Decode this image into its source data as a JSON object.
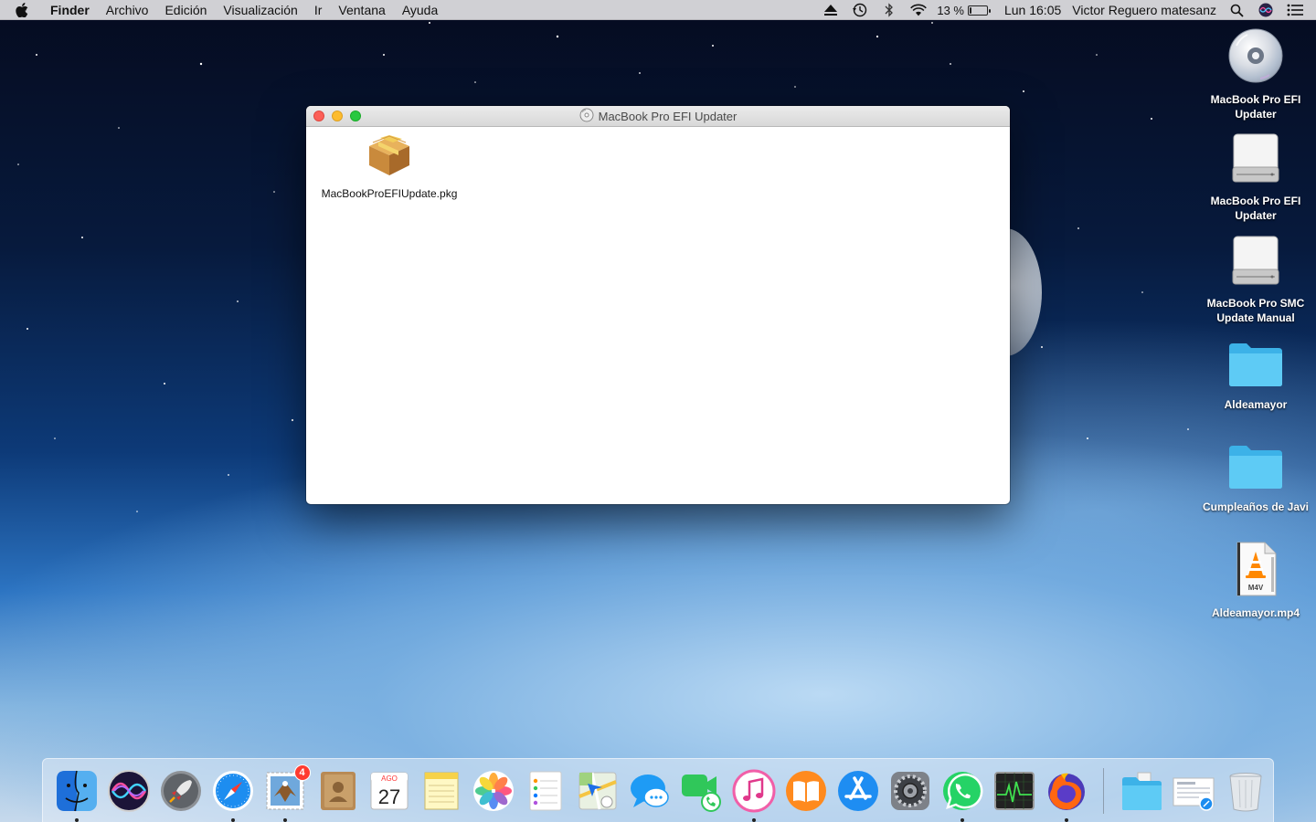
{
  "menubar": {
    "app_name": "Finder",
    "menus": [
      "Archivo",
      "Edición",
      "Visualización",
      "Ir",
      "Ventana",
      "Ayuda"
    ],
    "battery_percent": "13 %",
    "battery_level": 0.13,
    "clock": "Lun 16:05",
    "user_name": "Victor Reguero matesanz",
    "status_icons": [
      "eject-icon",
      "time-machine-icon",
      "bluetooth-icon",
      "wifi-icon",
      "battery-icon",
      "spotlight-search-icon",
      "siri-icon",
      "notification-center-icon"
    ]
  },
  "window": {
    "title": "MacBook Pro EFI Updater",
    "title_icon": "disc-icon",
    "files": [
      {
        "name": "MacBookProEFIUpdate.pkg",
        "icon": "package-icon"
      }
    ]
  },
  "desktop": {
    "icons": [
      {
        "label": "MacBook Pro EFI Updater",
        "icon": "cd-disc-icon"
      },
      {
        "label": "MacBook Pro EFI Updater",
        "icon": "disk-image-icon"
      },
      {
        "label": "MacBook Pro SMC Update Manual",
        "icon": "disk-image-icon"
      },
      {
        "label": "Aldeamayor",
        "icon": "folder-icon"
      },
      {
        "label": "Cumpleaños de Javi",
        "icon": "folder-icon"
      },
      {
        "label": "Aldeamayor.mp4",
        "icon": "vlc-video-file-icon",
        "file_type": "M4V"
      }
    ]
  },
  "dock": {
    "apps": [
      {
        "name": "Finder",
        "running": true
      },
      {
        "name": "Siri",
        "running": false
      },
      {
        "name": "Launchpad",
        "running": false
      },
      {
        "name": "Safari",
        "running": true
      },
      {
        "name": "Mail",
        "running": true,
        "badge": "4"
      },
      {
        "name": "Contacts",
        "running": false
      },
      {
        "name": "Calendar",
        "running": false,
        "month": "AGO",
        "day": "27"
      },
      {
        "name": "Notes",
        "running": false
      },
      {
        "name": "Photos",
        "running": false
      },
      {
        "name": "Reminders",
        "running": false
      },
      {
        "name": "Maps",
        "running": false
      },
      {
        "name": "Messages",
        "running": false
      },
      {
        "name": "FaceTime",
        "running": false
      },
      {
        "name": "iTunes",
        "running": true
      },
      {
        "name": "iBooks",
        "running": false
      },
      {
        "name": "App Store",
        "running": false
      },
      {
        "name": "System Preferences",
        "running": false
      },
      {
        "name": "WhatsApp",
        "running": true
      },
      {
        "name": "Activity Monitor",
        "running": false
      },
      {
        "name": "Firefox",
        "running": true
      }
    ],
    "others": [
      {
        "name": "Downloads folder"
      },
      {
        "name": "Recent document"
      },
      {
        "name": "Trash"
      }
    ]
  }
}
